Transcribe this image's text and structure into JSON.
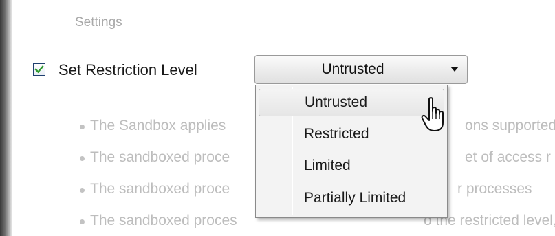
{
  "settings_group": {
    "title": "Settings"
  },
  "restriction": {
    "checkbox_label": "Set Restriction Level",
    "checked": true,
    "selected_value": "Untrusted",
    "options": [
      "Untrusted",
      "Restricted",
      "Limited",
      "Partially Limited"
    ],
    "hovered_option": "Untrusted"
  },
  "descriptions": [
    "The Sandbox applies",
    "The sandboxed proce",
    "The sandboxed proce",
    "The sandboxed proces"
  ],
  "descriptions_right": [
    "ons supported",
    "et of access r",
    "r processes",
    "o the restricted level,"
  ],
  "icons": {
    "checkbox_mark": "checkmark-icon",
    "combo_arrow": "chevron-down-icon",
    "pointer": "hand-pointer-icon"
  },
  "colors": {
    "checkmark": "#2f9a2f",
    "checkbox_border": "#1f3f6f"
  }
}
